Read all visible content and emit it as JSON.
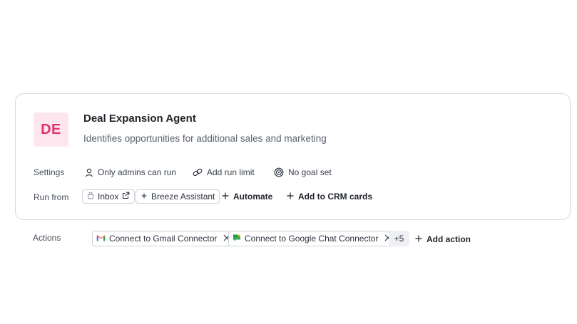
{
  "agent": {
    "initials": "DE",
    "name": "Deal Expansion Agent",
    "description": "Identifies opportunities for additional sales and marketing"
  },
  "settings": {
    "label": "Settings",
    "items": [
      {
        "icon": "person-icon",
        "text": "Only admins can run"
      },
      {
        "icon": "link-icon",
        "text": "Add run limit"
      },
      {
        "icon": "target-icon",
        "text": "No goal set"
      }
    ]
  },
  "run_from": {
    "label": "Run from",
    "chips": [
      {
        "icon": "lock-icon",
        "text": "Inbox",
        "trailing_icon": "external-link-icon"
      },
      {
        "icon": "sparkle-icon",
        "text": "Breeze Assistant"
      }
    ],
    "links": [
      {
        "text": "Automate"
      },
      {
        "text": "Add to CRM cards"
      }
    ]
  },
  "actions": {
    "label": "Actions",
    "chips": [
      {
        "icon": "gmail-icon",
        "text": "Connect to Gmail Connector"
      },
      {
        "icon": "google-chat-icon",
        "text": "Connect to Google Chat Connector"
      }
    ],
    "more_count": "+5",
    "add_label": "Add action"
  },
  "colors": {
    "avatar_bg": "#fde6ee",
    "avatar_text": "#e2346c",
    "border": "#d6d9de"
  }
}
